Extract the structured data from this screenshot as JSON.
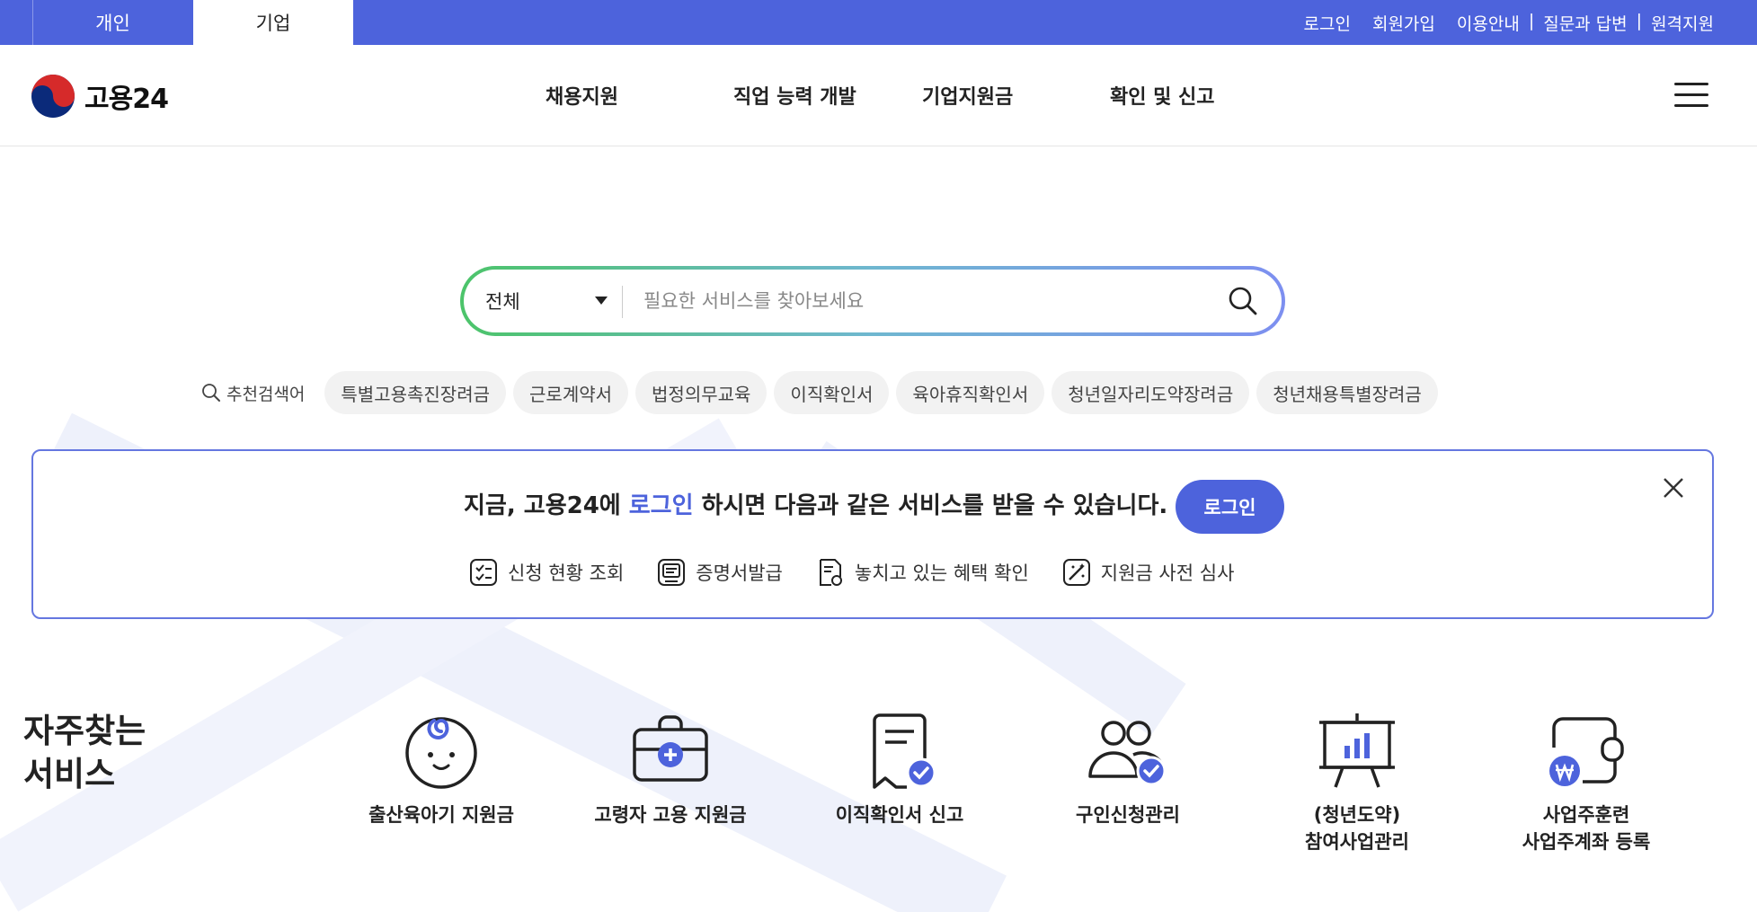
{
  "top_bar": {
    "tabs": [
      "개인",
      "기업"
    ],
    "links": [
      "로그인",
      "회원가입"
    ],
    "support_links": [
      "이용안내",
      "질문과 답변",
      "원격지원"
    ],
    "separator": "|"
  },
  "header": {
    "logo_text": "고용24",
    "nav": [
      "채용지원",
      "직업 능력 개발",
      "기업지원금",
      "확인 및 신고"
    ],
    "menu_icon": "hamburger-icon"
  },
  "search": {
    "scope": "전체",
    "placeholder": "필요한 서비스를 찾아보세요",
    "value": ""
  },
  "keywords": {
    "label": "추천검색어",
    "items": [
      "특별고용촉진장려금",
      "근로계약서",
      "법정의무교육",
      "이직확인서",
      "육아휴직확인서",
      "청년일자리도약장려금",
      "청년채용특별장려금"
    ]
  },
  "login_banner": {
    "message_pre": "지금, 고용24에 ",
    "message_highlight": "로그인",
    "message_post": " 하시면 다음과 같은 서비스를 받을 수 있습니다.",
    "login_button": "로그인",
    "features": [
      "신청 현황 조회",
      "증명서발급",
      "놓치고 있는 혜택 확인",
      "지원금 사전 심사"
    ]
  },
  "frequent_services": {
    "title_lines": [
      "자주찾는",
      "서비스"
    ],
    "items": [
      {
        "lines": [
          "출산육아기 지원금"
        ],
        "icon": "baby-face-icon"
      },
      {
        "lines": [
          "고령자 고용 지원금"
        ],
        "icon": "briefcase-plus-icon"
      },
      {
        "lines": [
          "이직확인서 신고"
        ],
        "icon": "document-check-icon"
      },
      {
        "lines": [
          "구인신청관리"
        ],
        "icon": "people-check-icon"
      },
      {
        "lines": [
          "(청년도약)",
          "참여사업관리"
        ],
        "icon": "presentation-chart-icon"
      },
      {
        "lines": [
          "사업주훈련",
          "사업주계좌 등록"
        ],
        "icon": "wallet-won-icon"
      }
    ]
  },
  "colors": {
    "brand": "#4d63dc",
    "gradient_start": "#4cc46a",
    "gradient_end": "#7d8ff0"
  }
}
